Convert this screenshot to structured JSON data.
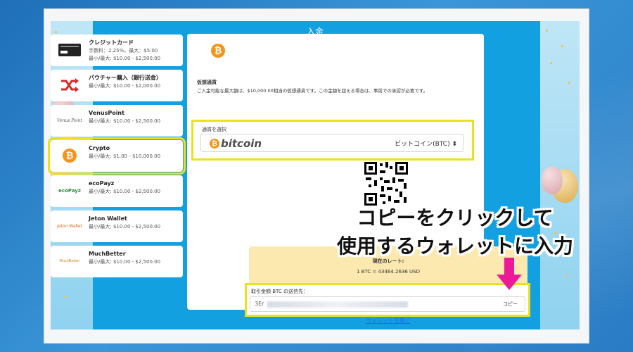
{
  "header": {
    "title": "入金"
  },
  "methods": [
    {
      "name": "クレジットカード",
      "detail1": "手数料：2.25%，最大：$5.00",
      "detail2": "最小/最大: $10.00 - $2,500.00",
      "icon": "credit-card-icon"
    },
    {
      "name": "バウチャー購入（銀行送金）",
      "detail1": "最小/最大: $10.00 - $2,000.00",
      "icon": "shuffle-icon"
    },
    {
      "name": "VenusPoint",
      "detail1": "最小/最大: $10.00 - $2,500.00",
      "logo_text": "Venus Point",
      "icon": "venuspoint-logo"
    },
    {
      "name": "Crypto",
      "detail1": "最小/最大: $1.00 - $10,000.00",
      "icon": "bitcoin-icon"
    },
    {
      "name": "ecoPayz",
      "detail1": "最小/最大: $10.00 - $2,500.00",
      "logo_text": "ecoPayz",
      "icon": "ecopayz-logo"
    },
    {
      "name": "Jeton Wallet",
      "detail1": "最小/最大: $10.00 - $2,500.00",
      "logo_text": "Jeton Wallet",
      "icon": "jeton-logo"
    },
    {
      "name": "MuchBetter",
      "detail1": "最小/最大: $10.00 - $2,500.00",
      "logo_text": "MuchBetter",
      "icon": "muchbetter-logo"
    }
  ],
  "content": {
    "coin_glyph": "₿",
    "section_label": "仮想通貨",
    "notice": "ご入金可能な最大額は、$10,000.00相当の仮想通貨です。この金額を超える場合は、事前での承認が必要です。",
    "currency_label": "通貨を選択",
    "bitcoin_word": "bitcoin",
    "currency_value": "ビットコイン(BTC) ⬍",
    "rate_title": "現在のレート:",
    "rate_value": "1 BTC = 43464.2636 USD",
    "address_label": "取引金額 BTC の送信先：",
    "address_value": "3Er",
    "copy_label": "コピー",
    "open_wallet": "ウォレットを開く"
  },
  "callout": {
    "line1": "コピーをクリックして",
    "line2": "使用するウォレットに入力"
  },
  "colors": {
    "highlight": "#e8e31d",
    "accent": "#12a0e0",
    "bitcoin": "#f7931a",
    "arrow": "#ec1a9b"
  }
}
